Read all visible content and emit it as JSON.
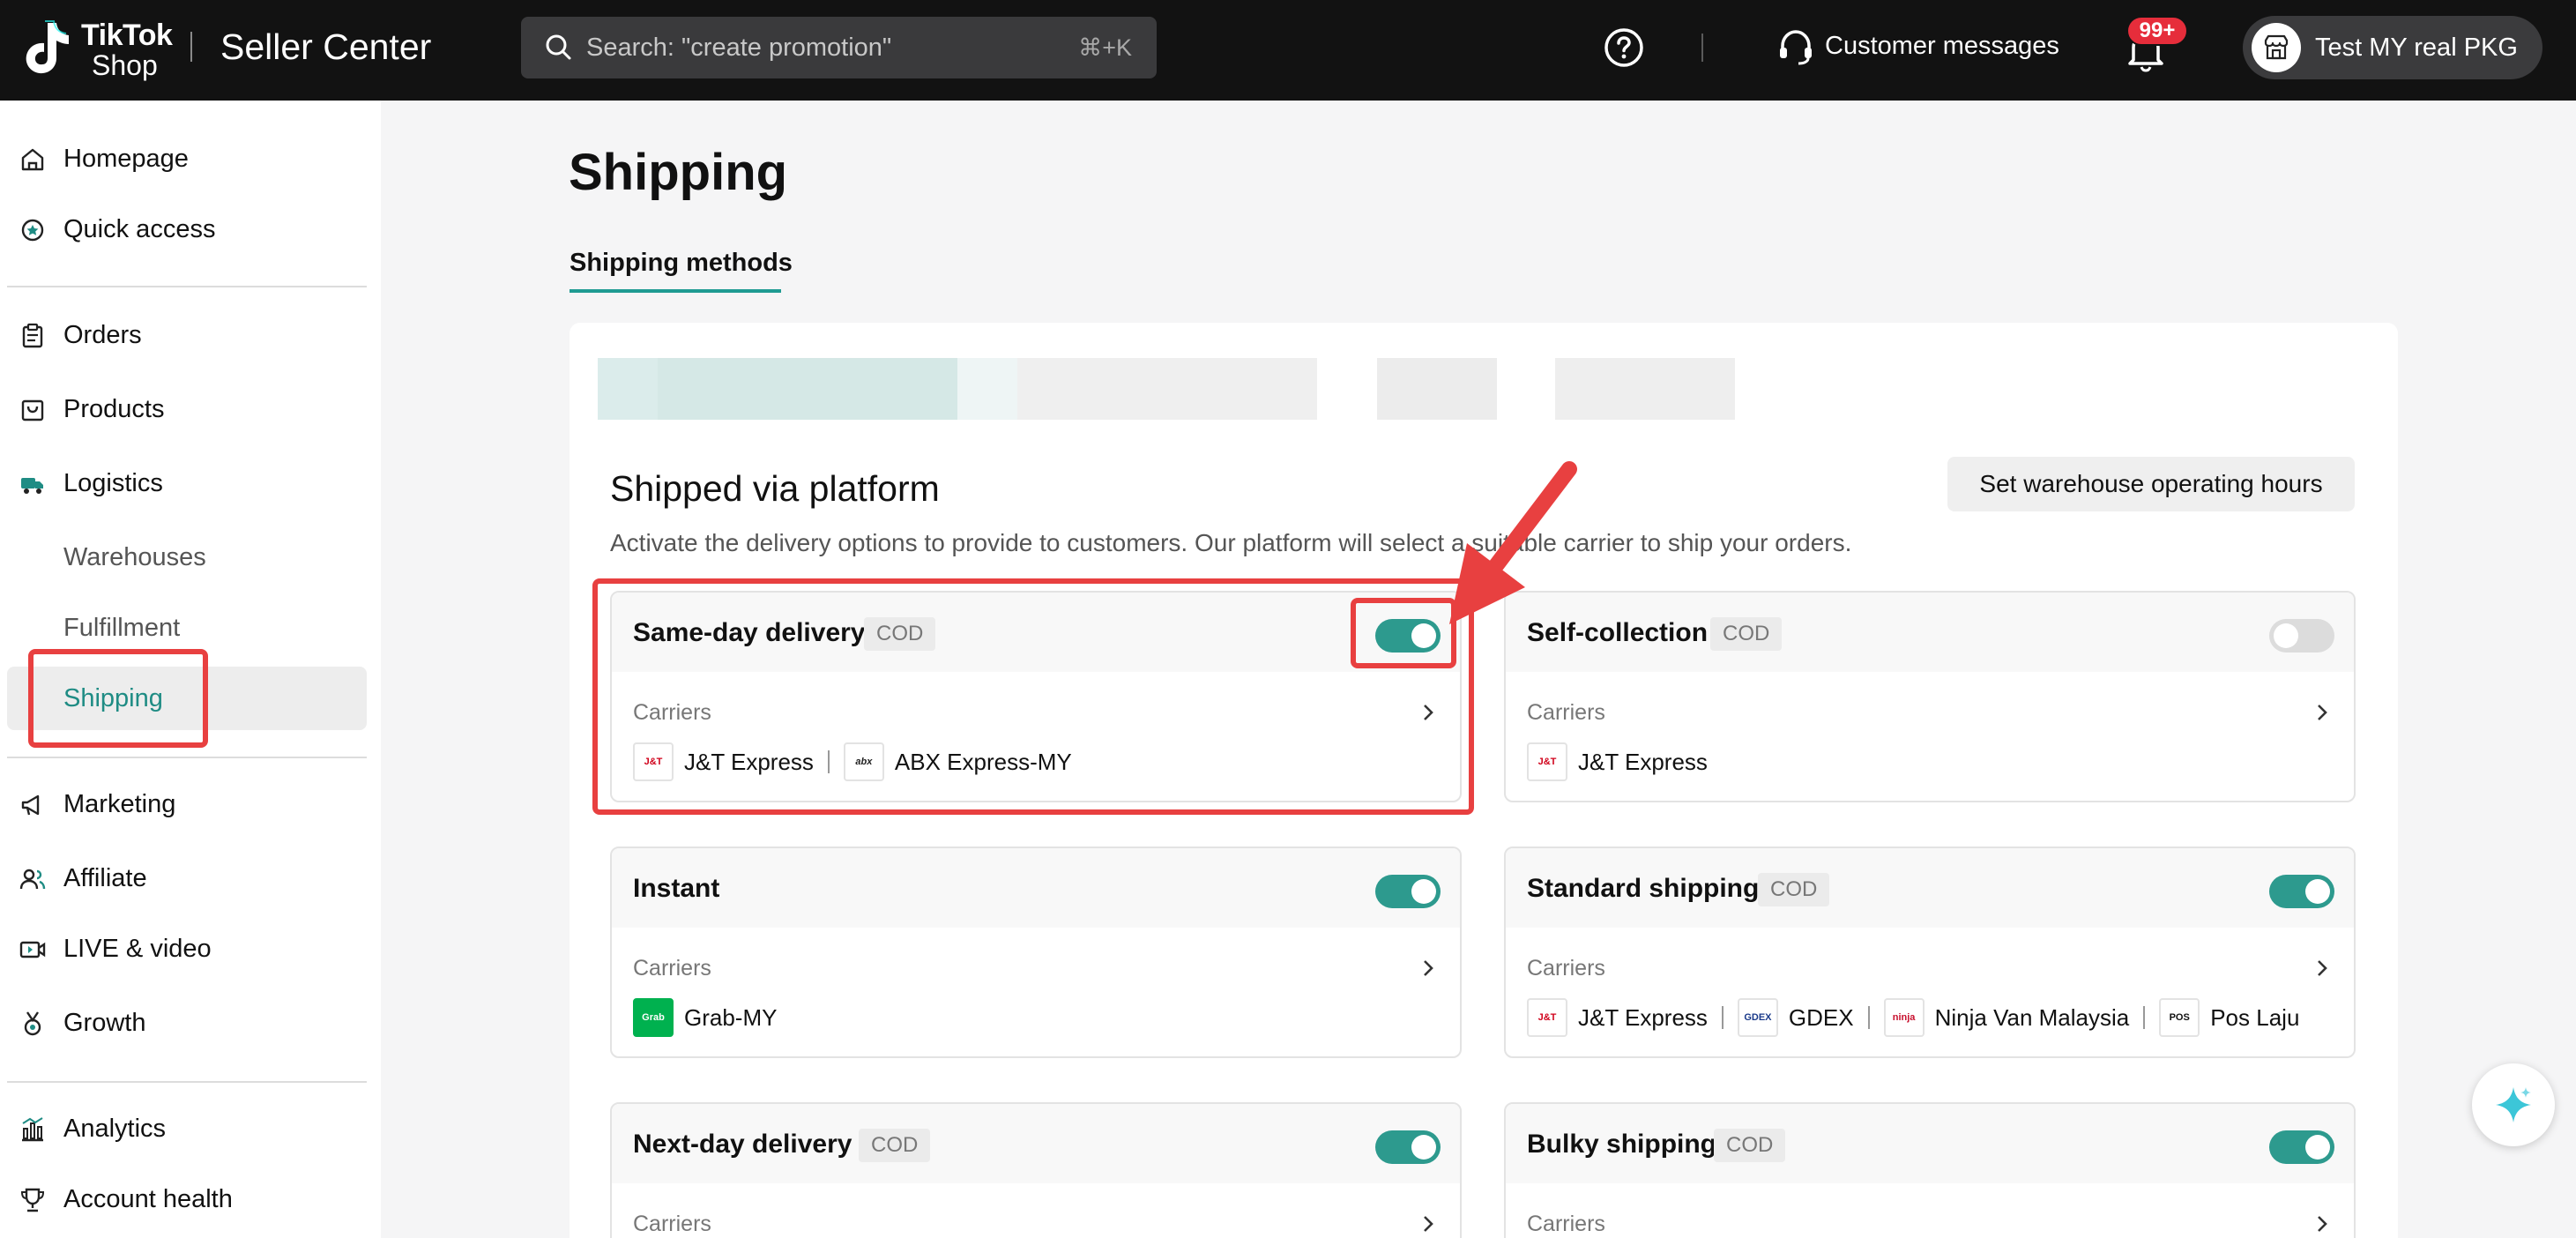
{
  "topbar": {
    "logo_line1": "TikTok",
    "logo_line2": "Shop",
    "brand": "Seller Center",
    "search_placeholder": "Search: \"create promotion\"",
    "search_shortcut": "⌘+K",
    "customer_messages": "Customer messages",
    "notification_badge": "99+",
    "user_name": "Test MY real PKG"
  },
  "sidebar": {
    "items": [
      {
        "label": "Homepage",
        "icon": "home-icon"
      },
      {
        "label": "Quick access",
        "icon": "star-circle-icon"
      },
      {
        "label": "Orders",
        "icon": "clipboard-icon"
      },
      {
        "label": "Products",
        "icon": "product-box-icon"
      },
      {
        "label": "Logistics",
        "icon": "truck-icon"
      },
      {
        "label": "Warehouses"
      },
      {
        "label": "Fulfillment"
      },
      {
        "label": "Shipping"
      },
      {
        "label": "Marketing",
        "icon": "megaphone-icon"
      },
      {
        "label": "Affiliate",
        "icon": "people-icon"
      },
      {
        "label": "LIVE & video",
        "icon": "video-icon"
      },
      {
        "label": "Growth",
        "icon": "medal-icon"
      },
      {
        "label": "Analytics",
        "icon": "bar-chart-icon"
      },
      {
        "label": "Account health",
        "icon": "trophy-icon"
      }
    ],
    "active": "Shipping"
  },
  "main": {
    "title": "Shipping",
    "tab": "Shipping methods",
    "section_title": "Shipped via platform",
    "section_desc": "Activate the delivery options to provide to customers. Our platform will select a suitable carrier to ship your orders.",
    "warehouse_button": "Set warehouse operating hours",
    "carriers_label": "Carriers",
    "methods": [
      {
        "name": "Same-day delivery",
        "badge": "COD",
        "enabled": true,
        "carriers": [
          "J&T Express",
          "ABX Express-MY"
        ]
      },
      {
        "name": "Self-collection",
        "badge": "COD",
        "enabled": false,
        "carriers": [
          "J&T Express"
        ]
      },
      {
        "name": "Instant",
        "badge": "",
        "enabled": true,
        "carriers": [
          "Grab-MY"
        ]
      },
      {
        "name": "Standard shipping",
        "badge": "COD",
        "enabled": true,
        "carriers": [
          "J&T Express",
          "GDEX",
          "Ninja Van Malaysia",
          "Pos Laju"
        ]
      },
      {
        "name": "Next-day delivery",
        "badge": "COD",
        "enabled": true,
        "carriers": []
      },
      {
        "name": "Bulky shipping",
        "badge": "COD",
        "enabled": true,
        "carriers": []
      }
    ]
  },
  "colors": {
    "accent": "#2d9a8e",
    "annotation": "#e84040",
    "topbar": "#121212"
  }
}
